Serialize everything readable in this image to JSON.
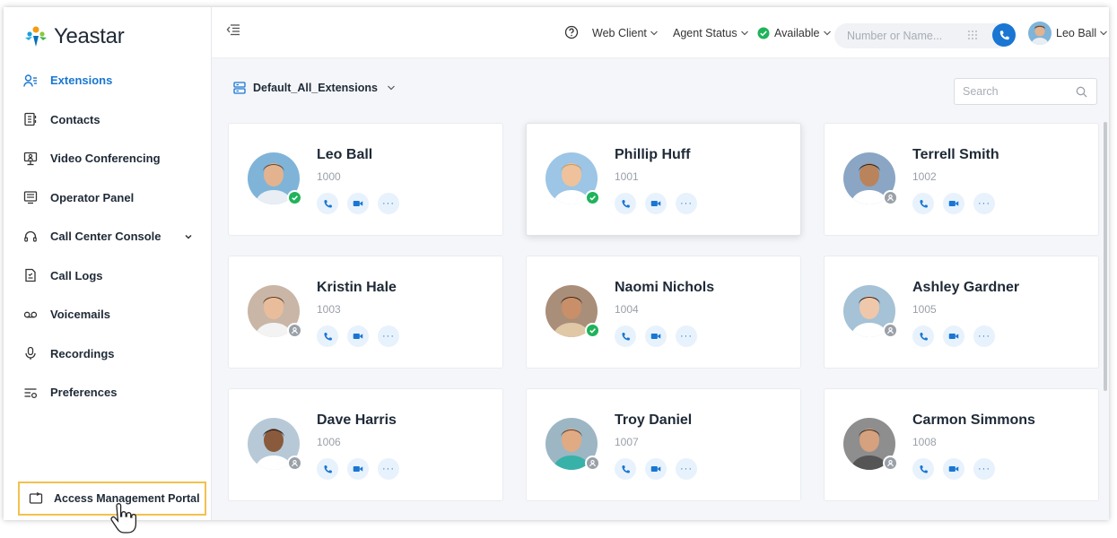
{
  "app": {
    "brand": "Yeastar"
  },
  "sidebar": {
    "items": [
      {
        "label": "Extensions",
        "icon": "extensions-icon",
        "active": true
      },
      {
        "label": "Contacts",
        "icon": "contacts-icon"
      },
      {
        "label": "Video Conferencing",
        "icon": "video-conference-icon"
      },
      {
        "label": "Operator Panel",
        "icon": "operator-panel-icon"
      },
      {
        "label": "Call Center Console",
        "icon": "headset-icon",
        "expandable": true
      },
      {
        "label": "Call Logs",
        "icon": "call-logs-icon"
      },
      {
        "label": "Voicemails",
        "icon": "voicemail-icon"
      },
      {
        "label": "Recordings",
        "icon": "microphone-icon"
      },
      {
        "label": "Preferences",
        "icon": "preferences-icon"
      }
    ],
    "portal_label": "Access Management Portal"
  },
  "header": {
    "web_client": "Web Client",
    "agent_status": "Agent Status",
    "availability": "Available",
    "search_placeholder": "Number or Name...",
    "user": "Leo Ball"
  },
  "main": {
    "group": "Default_All_Extensions",
    "search_placeholder": "Search"
  },
  "extensions": [
    {
      "name": "Leo Ball",
      "ext": "1000",
      "status": "available"
    },
    {
      "name": "Phillip Huff",
      "ext": "1001",
      "status": "available"
    },
    {
      "name": "Terrell Smith",
      "ext": "1002",
      "status": "offline"
    },
    {
      "name": "Kristin Hale",
      "ext": "1003",
      "status": "offline"
    },
    {
      "name": "Naomi Nichols",
      "ext": "1004",
      "status": "available"
    },
    {
      "name": "Ashley Gardner",
      "ext": "1005",
      "status": "offline"
    },
    {
      "name": "Dave Harris",
      "ext": "1006",
      "status": "offline"
    },
    {
      "name": "Troy Daniel",
      "ext": "1007",
      "status": "offline"
    },
    {
      "name": "Carmon Simmons",
      "ext": "1008",
      "status": "offline"
    }
  ],
  "colors": {
    "accent": "#1976d2",
    "available": "#1fb35a",
    "offline": "#9aa0a8",
    "highlight": "#f2c14e"
  }
}
